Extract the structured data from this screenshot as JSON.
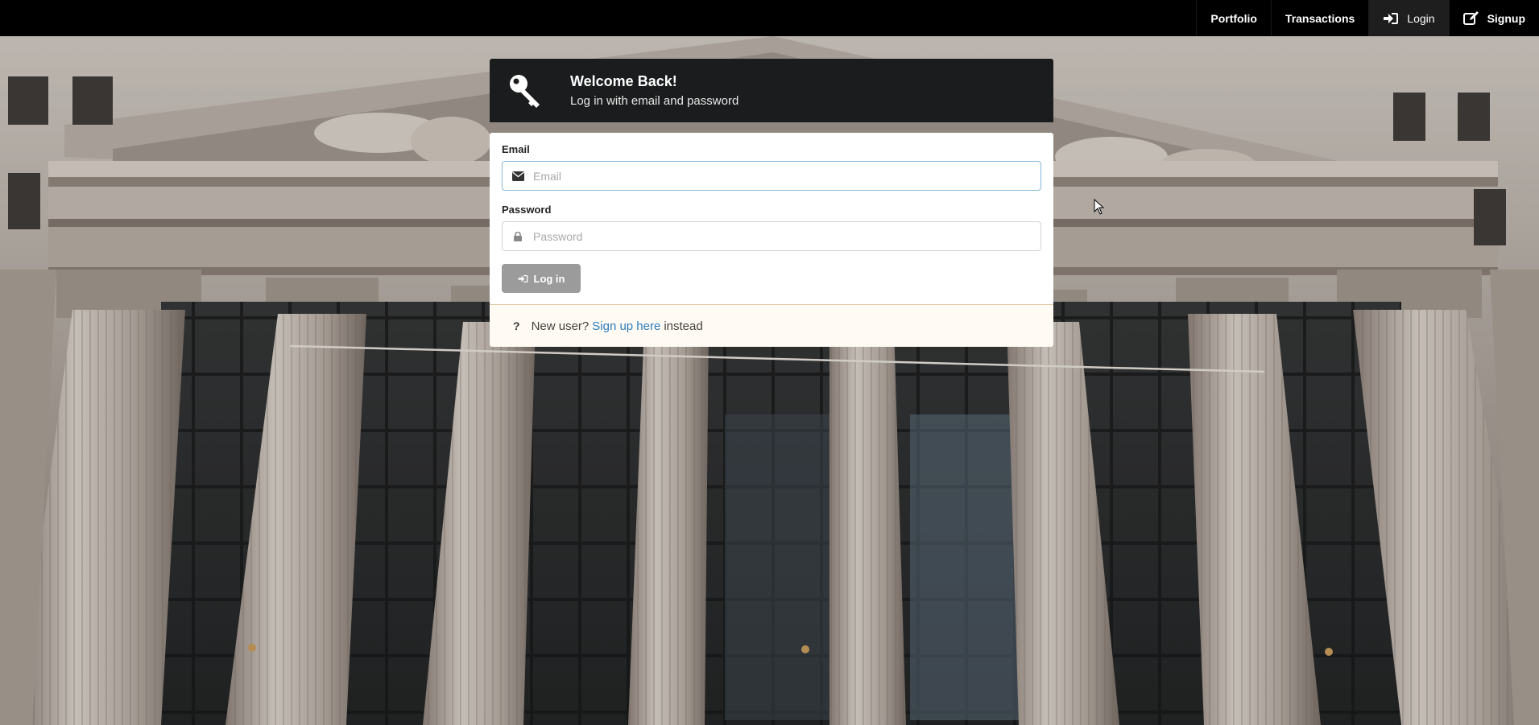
{
  "navbar": {
    "items": [
      {
        "label": "Portfolio",
        "icon": "",
        "active": false
      },
      {
        "label": "Transactions",
        "icon": "",
        "active": false
      },
      {
        "label": "Login",
        "icon": "sign-in-icon",
        "active": true
      },
      {
        "label": "Signup",
        "icon": "edit-icon",
        "active": false
      }
    ]
  },
  "login": {
    "header_title": "Welcome Back!",
    "header_subtitle": "Log in with email and password",
    "header_icon": "key-icon",
    "email_label": "Email",
    "email_placeholder": "Email",
    "email_value": "",
    "password_label": "Password",
    "password_placeholder": "Password",
    "password_value": "",
    "submit_label": "Log in"
  },
  "message": {
    "prefix": "New user?",
    "link_text": "Sign up here",
    "suffix": "instead"
  },
  "colors": {
    "navbar_bg": "#000000",
    "header_bg": "#1b1c1d",
    "button_bg": "#9b9b9b",
    "link": "#2d7cbd",
    "message_bg": "#fffaf3"
  }
}
